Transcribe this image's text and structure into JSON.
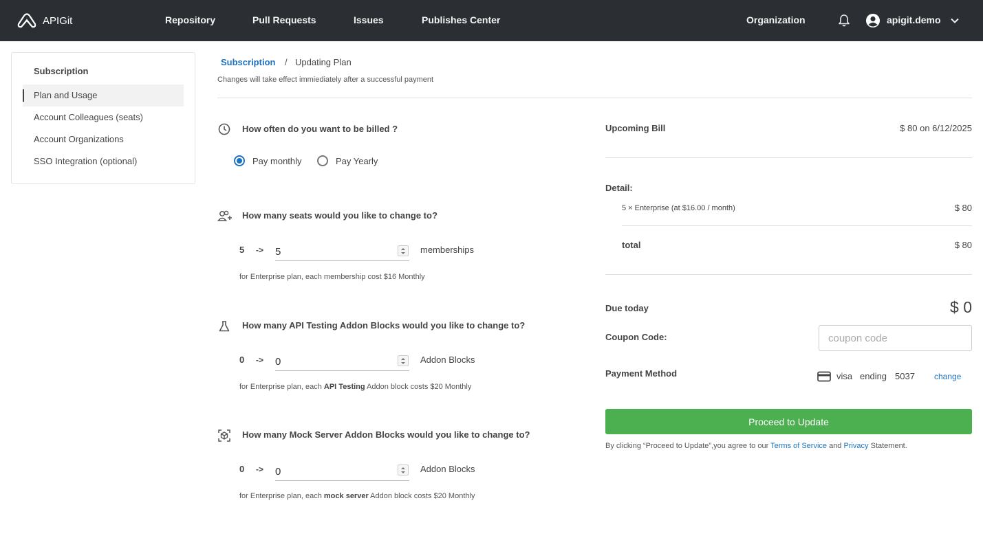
{
  "topbar": {
    "brand": "APIGit",
    "nav": [
      "Repository",
      "Pull Requests",
      "Issues",
      "Publishes Center"
    ],
    "organization": "Organization",
    "username": "apigit.demo"
  },
  "sidebar": {
    "title": "Subscription",
    "items": [
      "Plan and Usage",
      "Account Colleagues (seats)",
      "Account Organizations",
      "SSO Integration (optional)"
    ],
    "active_index": 0
  },
  "breadcrumb": {
    "parent": "Subscription",
    "separator": "/",
    "current": "Updating Plan"
  },
  "subtitle": "Changes will take effect immiediately after a successful payment",
  "billing": {
    "question": "How often do you want to be billed ?",
    "options": [
      "Pay monthly",
      "Pay Yearly"
    ],
    "selected": "Pay monthly"
  },
  "seats": {
    "question": "How many seats would you like to change to?",
    "current": "5",
    "arrow": "->",
    "value": "5",
    "unit": "memberships",
    "note": "for Enterprise plan, each membership cost $16 Monthly"
  },
  "api_testing": {
    "question": "How many API Testing Addon Blocks would you like to change to?",
    "current": "0",
    "arrow": "->",
    "value": "0",
    "unit": "Addon Blocks",
    "note_prefix": "for Enterprise plan, each ",
    "note_bold": "API Testing",
    "note_suffix": " Addon block costs $20 Monthly"
  },
  "mock_server": {
    "question": "How many Mock Server Addon Blocks would you like to change to?",
    "current": "0",
    "arrow": "->",
    "value": "0",
    "unit": "Addon Blocks",
    "note_prefix": "for Enterprise plan, each ",
    "note_bold": "mock server",
    "note_suffix": " Addon block costs $20 Monthly"
  },
  "summary": {
    "upcoming_label": "Upcoming Bill",
    "upcoming_value": "$ 80 on 6/12/2025",
    "detail_label": "Detail:",
    "detail_item": "5 × Enterprise (at $16.00 / month)",
    "detail_item_value": "$ 80",
    "total_label": "total",
    "total_value": "$ 80",
    "due_label": "Due today",
    "due_value": "$ 0",
    "coupon_label": "Coupon Code:",
    "coupon_placeholder": "coupon code",
    "payment_label": "Payment Method",
    "card_brand": "visa",
    "card_ending_label": "ending",
    "card_last4": "5037",
    "change_label": "change",
    "proceed_label": "Proceed to Update",
    "terms_prefix": "By clicking “Proceed to Update”,you agree to our ",
    "terms_link": "Terms of Service",
    "terms_and": " and ",
    "privacy_link": "Privacy",
    "terms_suffix": " Statement."
  },
  "colors": {
    "topbar": "#2b2f33",
    "accent": "#1e73be",
    "proceed": "#4caf50"
  }
}
